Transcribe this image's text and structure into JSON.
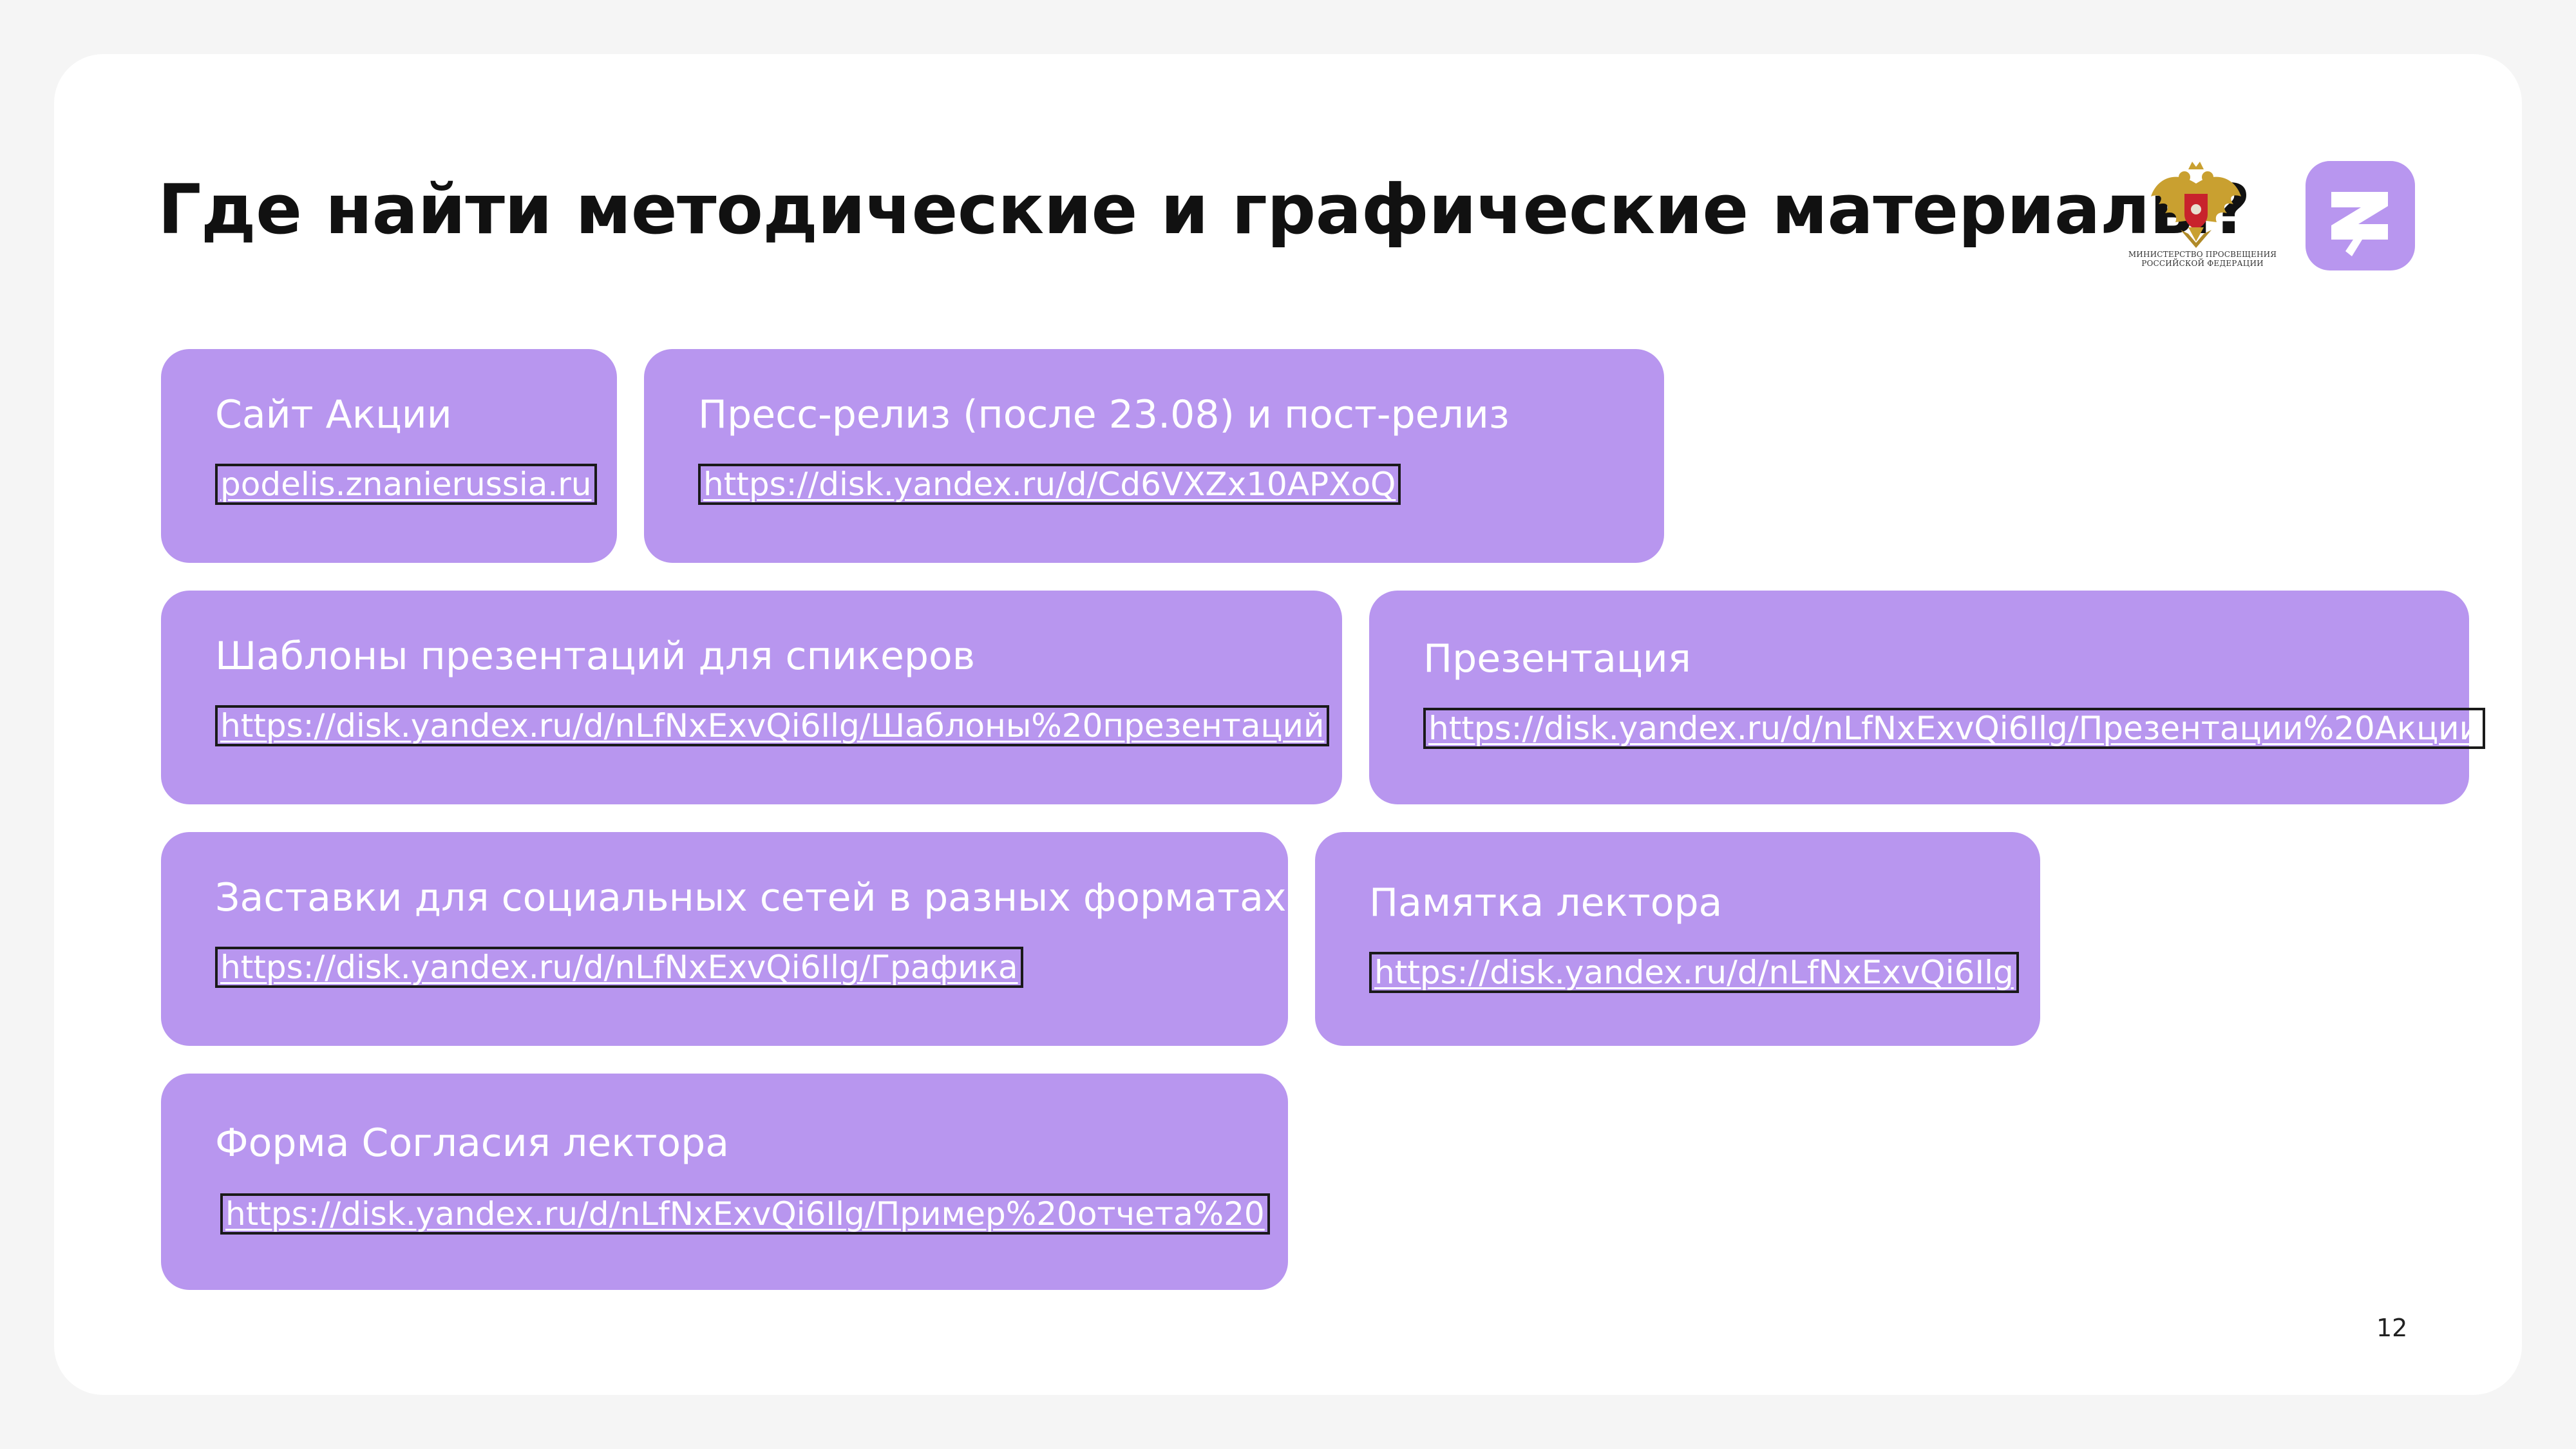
{
  "slide": {
    "title": "Где найти методические и графические материалы?",
    "page_number": "12",
    "accent_color": "#b896ef"
  },
  "logos": {
    "ministry_caption_line1": "МИНИСТЕРСТВО ПРОСВЕЩЕНИЯ",
    "ministry_caption_line2": "РОССИЙСКОЙ ФЕДЕРАЦИИ",
    "ministry_icon": "double-headed-eagle-emblem",
    "brand_icon": "znanie-logo"
  },
  "cards": [
    {
      "label": "Сайт Акции",
      "link": "podelis.znanierussia.ru"
    },
    {
      "label": "Пресс-релиз (после 23.08) и пост-релиз",
      "link": "https://disk.yandex.ru/d/Cd6VXZx10APXoQ"
    },
    {
      "label": "Шаблоны презентаций для спикеров",
      "link": "https://disk.yandex.ru/d/nLfNxExvQi6Ilg/Шаблоны%20презентаций"
    },
    {
      "label": "Презентация",
      "link": "https://disk.yandex.ru/d/nLfNxExvQi6Ilg/Презентации%20Акции"
    },
    {
      "label": "Заставки для социальных сетей в разных форматах",
      "link": "https://disk.yandex.ru/d/nLfNxExvQi6Ilg/Графика"
    },
    {
      "label": "Памятка лектора",
      "link": "https://disk.yandex.ru/d/nLfNxExvQi6Ilg"
    },
    {
      "label": "Форма Согласия лектора",
      "link": "https://disk.yandex.ru/d/nLfNxExvQi6Ilg/Пример%20отчета%20"
    }
  ]
}
